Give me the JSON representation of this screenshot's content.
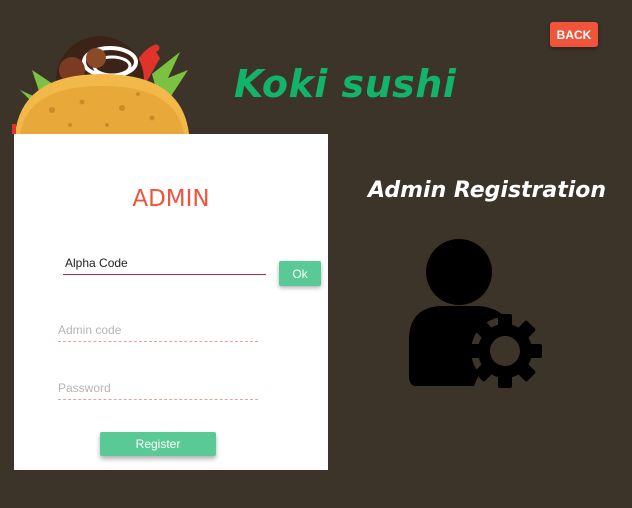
{
  "brand": {
    "name": "Koki sushi",
    "logo_icon": "taco-icon"
  },
  "header": {
    "back_label": "BACK"
  },
  "login_card": {
    "title": "ADMIN",
    "alpha_code_value": "Alpha Code",
    "ok_label": "Ok",
    "admin_code_placeholder": "Admin code",
    "password_placeholder": "Password",
    "register_label": "Register"
  },
  "side": {
    "title": "Admin Registration",
    "icon": "admin-settings-icon"
  },
  "colors": {
    "background": "#3d3429",
    "brand": "#12b36a",
    "accent": "#f0543a",
    "button": "#59c995",
    "card": "#ffffff"
  }
}
